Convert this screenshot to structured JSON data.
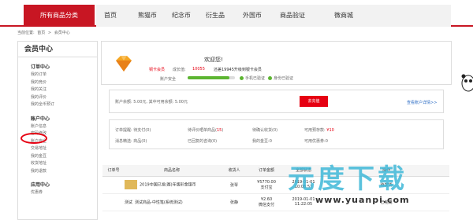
{
  "header": {
    "category_button": "所有商品分类",
    "nav": [
      "首页",
      "熊猫币",
      "纪念币",
      "衍生品",
      "外国币",
      "商品验证",
      "微商城"
    ]
  },
  "breadcrumb": {
    "prefix": "当前位置:",
    "home": "首页",
    "sep1": ">",
    "current": "会员中心"
  },
  "sidebar": {
    "title": "会员中心",
    "order_center": {
      "title": "订单中心",
      "items": [
        "我的订单",
        "我的竞价",
        "我的关注",
        "我的评价",
        "我的全币预订"
      ]
    },
    "account_center": {
      "title": "账户中心",
      "items": [
        "账户信息",
        "密码修改",
        "账户安全",
        "交易地址",
        "我的金豆",
        "收货地址",
        "我的退款"
      ]
    },
    "app_center": {
      "title": "应用中心",
      "items": [
        "优惠券"
      ]
    }
  },
  "profile": {
    "welcome": "欢迎您!",
    "level": "铜卡会员",
    "growth_label": "成长值:",
    "growth_value": "10055",
    "upgrade_text": "还差19945升级到银卡会员",
    "security_label": "账户安全",
    "phone_verified": "手机已验证",
    "id_verified": "身份已验证",
    "security_progress": 0.88
  },
  "balance": {
    "text": "账户余额: 5.00元, 其中可用余额: 5.00元",
    "recharge_button": "去充值",
    "details_link": "查看账户详情>>"
  },
  "stats": {
    "row1": [
      {
        "label": "订单提醒:",
        "value": "待支付(0)"
      },
      {
        "label": "待评价晒单商品(",
        "value": "15",
        "suffix": ")"
      },
      {
        "label": "待确认收货(",
        "value": "0",
        "suffix": ")"
      },
      {
        "label": "可用预存款:",
        "value": "¥10"
      }
    ],
    "row2": [
      {
        "label": "消息精选:",
        "value": "商品(0)"
      },
      {
        "label": "已回复的咨询(",
        "value": "0",
        "suffix": ")"
      },
      {
        "label": "我的金豆:",
        "value": "0"
      },
      {
        "label": "可用优惠券:",
        "value": "0"
      }
    ]
  },
  "orders": {
    "headers": [
      "订单号",
      "商品名称",
      "收货人",
      "订单金额",
      "全部状态",
      "操作"
    ],
    "rows": [
      {
        "name": "2019中国已发(赛)年版形金银币",
        "receiver": "张琴",
        "amount": "¥5770.00",
        "pay": "支付宝",
        "date": "2019-01-01",
        "time": "10:08:57",
        "status": "待发货"
      },
      {
        "name": "测试商品-中性笔(系统测试)",
        "receiver": "张静",
        "amount": "¥2.60",
        "pay": "微信支付",
        "date": "2019-01-01",
        "time": "11:22:05",
        "status": "已完成"
      }
    ],
    "test_label": "测试"
  },
  "watermark": {
    "text": "元度下载",
    "url": "www.yuanpi.com"
  }
}
